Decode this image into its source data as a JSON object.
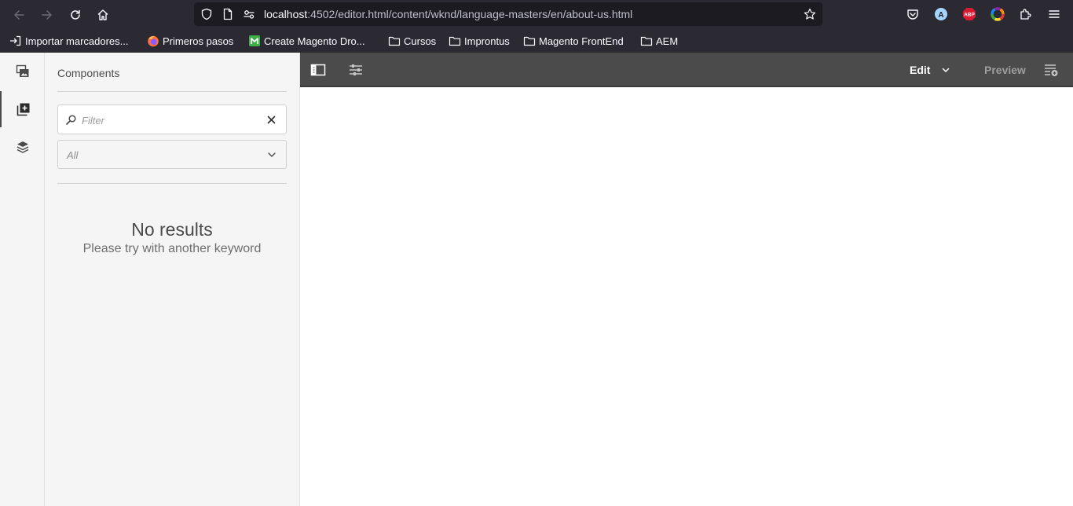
{
  "browser": {
    "url_host": "localhost",
    "url_path": ":4502/editor.html/content/wknd/language-masters/en/about-us.html",
    "nav_icons": [
      "back-arrow-icon",
      "forward-arrow-icon",
      "reload-icon",
      "home-icon"
    ],
    "url_icons": [
      "shield-icon",
      "page-icon",
      "connection-icon",
      "star-icon"
    ],
    "extension_icons": [
      "pocket-icon",
      "account-icon",
      "adblock-icon",
      "color-wheel-icon",
      "puzzle-icon",
      "hamburger-menu-icon"
    ],
    "account_initial": "A",
    "adblock_label": "ABP",
    "bookmarks": [
      {
        "label": "Importar marcadores...",
        "icon": "import-icon"
      },
      {
        "label": "Primeros pasos",
        "icon": "firefox-icon"
      },
      {
        "label": "Create Magento Dro...",
        "icon": "magento-icon"
      },
      {
        "label": "Cursos",
        "icon": "folder-icon"
      },
      {
        "label": "Improntus",
        "icon": "folder-icon"
      },
      {
        "label": "Magento FrontEnd",
        "icon": "folder-icon"
      },
      {
        "label": "AEM",
        "icon": "folder-icon"
      }
    ],
    "colors": {
      "chrome_bg": "#2b2a33",
      "urlbar_bg": "#1c1b22",
      "adblock_red": "#d91a33",
      "account_blue": "#a4d5ff"
    }
  },
  "editor": {
    "side_rail": [
      {
        "name": "assets-icon",
        "active": false
      },
      {
        "name": "components-icon",
        "active": true
      },
      {
        "name": "content-tree-icon",
        "active": false
      }
    ],
    "panel": {
      "title": "Components",
      "filter_placeholder": "Filter",
      "filter_value": "",
      "group_select": "All",
      "no_results_title": "No results",
      "no_results_subtitle": "Please try with another keyword"
    },
    "toolbar": {
      "left_icons": [
        "toggle-side-panel-icon",
        "page-properties-icon"
      ],
      "mode": "Edit",
      "preview_label": "Preview",
      "right_icon": "annotations-icon"
    },
    "colors": {
      "toolbar_bg": "#4b4b4b",
      "panel_bg": "#f5f5f5",
      "text_dark": "#4b4b4b"
    }
  }
}
